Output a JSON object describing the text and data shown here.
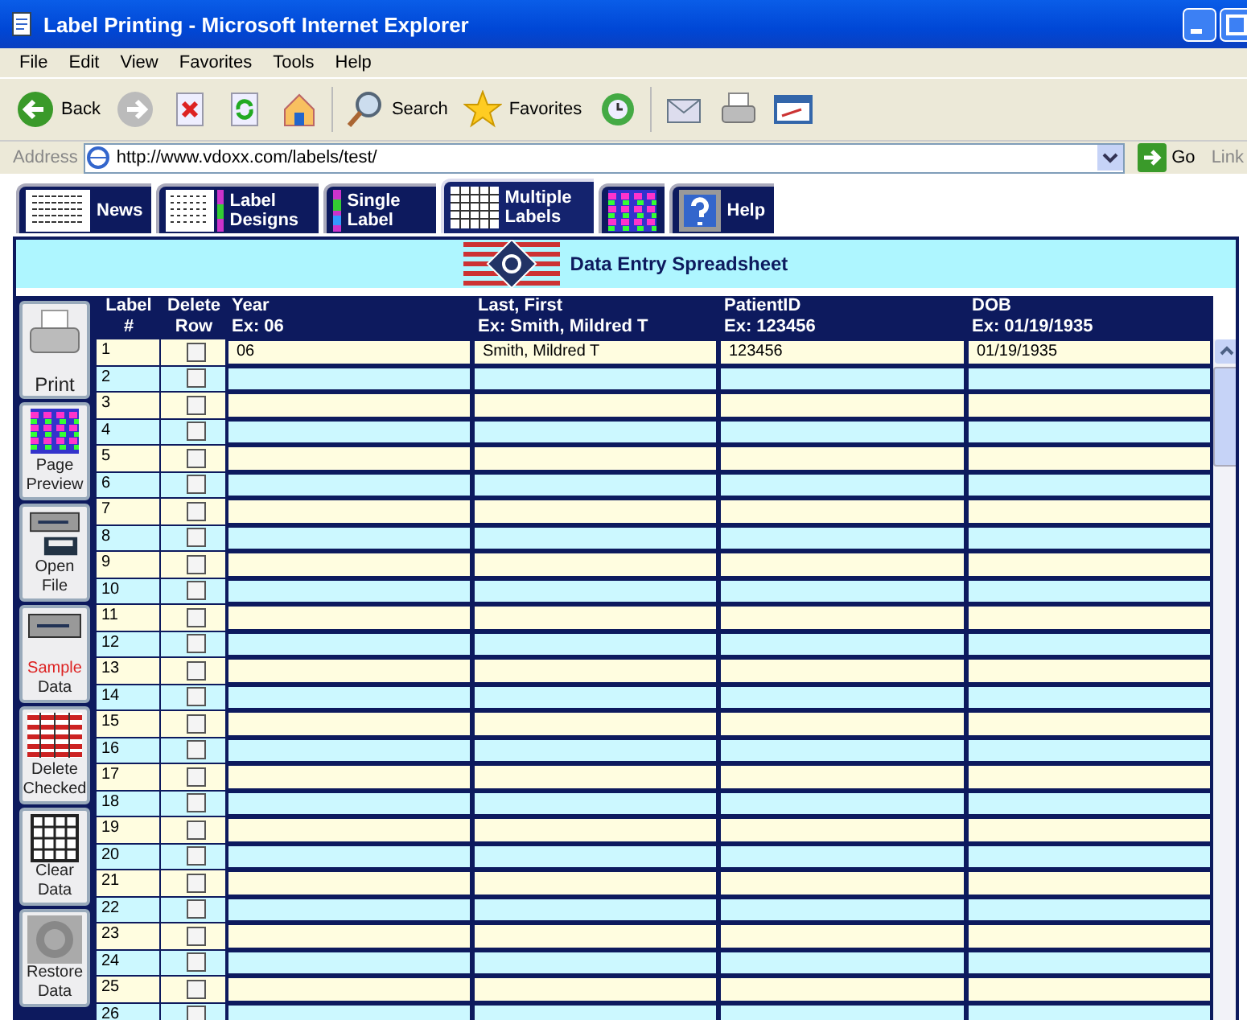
{
  "window": {
    "title": "Label Printing - Microsoft Internet Explorer"
  },
  "menu": [
    "File",
    "Edit",
    "View",
    "Favorites",
    "Tools",
    "Help"
  ],
  "toolbar": [
    {
      "kind": "back",
      "label": "Back"
    },
    {
      "kind": "forward"
    },
    {
      "kind": "stop"
    },
    {
      "kind": "refresh"
    },
    {
      "kind": "home"
    },
    {
      "kind": "search",
      "label": "Search"
    },
    {
      "kind": "favorites",
      "label": "Favorites"
    },
    {
      "kind": "history"
    },
    {
      "kind": "mail"
    },
    {
      "kind": "print"
    },
    {
      "kind": "edit"
    }
  ],
  "address": {
    "label": "Address",
    "url": "http://www.vdoxx.com/labels/test/",
    "go": "Go",
    "links": "Link"
  },
  "tabs": [
    {
      "kind": "news",
      "label": "News",
      "selected": false
    },
    {
      "kind": "designs",
      "label": "Label Designs",
      "selected": false
    },
    {
      "kind": "single",
      "label": "Single Label",
      "selected": false
    },
    {
      "kind": "multiple",
      "label": "Multiple Labels",
      "selected": true
    },
    {
      "kind": "preview",
      "selected": false
    },
    {
      "kind": "help",
      "label": "Help",
      "selected": false
    }
  ],
  "heading": "Data Entry Spreadsheet",
  "side_buttons": [
    {
      "kind": "print",
      "lines": [
        {
          "text": "Print",
          "warning": false
        }
      ]
    },
    {
      "kind": "preview",
      "lines": [
        {
          "text": "Page",
          "warning": false
        },
        {
          "text": "Preview",
          "warning": false
        }
      ]
    },
    {
      "kind": "open",
      "lines": [
        {
          "text": "Open",
          "warning": false
        },
        {
          "text": "File",
          "warning": false
        }
      ]
    },
    {
      "kind": "sample",
      "lines": [
        {
          "text": "Sample",
          "warning": true
        },
        {
          "text": "Data",
          "warning": false
        }
      ]
    },
    {
      "kind": "delete",
      "lines": [
        {
          "text": "Delete",
          "warning": false
        },
        {
          "text": "Checked",
          "warning": false
        }
      ]
    },
    {
      "kind": "clear",
      "lines": [
        {
          "text": "Clear",
          "warning": false
        },
        {
          "text": "Data",
          "warning": false
        }
      ]
    },
    {
      "kind": "restore",
      "lines": [
        {
          "text": "Restore",
          "warning": false
        },
        {
          "text": "Data",
          "warning": false
        }
      ]
    }
  ],
  "table": {
    "columns": [
      [
        "Label",
        "#"
      ],
      [
        "Delete",
        "Row"
      ],
      [
        "Year",
        "Ex: 06"
      ],
      [
        "Last, First",
        "Ex: Smith, Mildred T"
      ],
      [
        "PatientID",
        "Ex: 123456"
      ],
      [
        "DOB",
        "Ex: 01/19/1935"
      ]
    ],
    "rows": [
      {
        "number": "1",
        "checked": false,
        "cells": [
          "06",
          "Smith, Mildred T",
          "123456",
          "01/19/1935"
        ]
      },
      {
        "number": "2",
        "checked": false
      },
      {
        "number": "3",
        "checked": false
      },
      {
        "number": "4",
        "checked": false
      },
      {
        "number": "5",
        "checked": false
      },
      {
        "number": "6",
        "checked": false
      },
      {
        "number": "7",
        "checked": false
      },
      {
        "number": "8",
        "checked": false
      },
      {
        "number": "9",
        "checked": false
      },
      {
        "number": "10",
        "checked": false
      },
      {
        "number": "11",
        "checked": false
      },
      {
        "number": "12",
        "checked": false
      },
      {
        "number": "13",
        "checked": false
      },
      {
        "number": "14",
        "checked": false
      },
      {
        "number": "15",
        "checked": false
      },
      {
        "number": "16",
        "checked": false
      },
      {
        "number": "17",
        "checked": false
      },
      {
        "number": "18",
        "checked": false
      },
      {
        "number": "19",
        "checked": false
      },
      {
        "number": "20",
        "checked": false
      },
      {
        "number": "21",
        "checked": false
      },
      {
        "number": "22",
        "checked": false
      },
      {
        "number": "23",
        "checked": false
      },
      {
        "number": "24",
        "checked": false
      },
      {
        "number": "25",
        "checked": false
      },
      {
        "number": "26",
        "checked": false
      }
    ]
  }
}
